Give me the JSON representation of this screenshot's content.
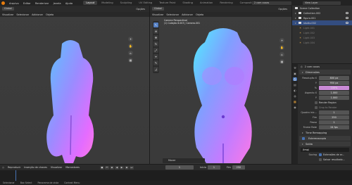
{
  "topbar": {
    "menus": [
      "Arquivo",
      "Editar",
      "Renderizar",
      "Janela",
      "Ajuda"
    ],
    "workspaces": [
      "Layout",
      "Modeling",
      "Sculpting",
      "UV Editing",
      "Texture Paint",
      "Shading",
      "Animation",
      "Rendering",
      "Compositing",
      "Scrip"
    ],
    "active_workspace": "Layout",
    "scene_name": "2 com coxas",
    "view_layer": "View Layer"
  },
  "viewport_left": {
    "header_tools": [
      "Global",
      "Opções"
    ],
    "menu": [
      "Visualizar",
      "Selecionar",
      "Adicionar",
      "Objeto"
    ]
  },
  "viewport_right": {
    "header_tools": [
      "Global",
      "Opções"
    ],
    "menu": [
      "Visualizar",
      "Selecionar",
      "Adicionar",
      "Objeto"
    ],
    "info_line1": "Camera Perspectival",
    "info_line2": "(1) Coleção 8.003 | Camera.001",
    "last_op": "Mover"
  },
  "outliner": {
    "title": "Scene Collection",
    "items": [
      {
        "label": "Collection.002",
        "selected": false,
        "dim": false
      },
      {
        "label": "figura.001",
        "selected": false,
        "dim": false
      },
      {
        "label": "studio.002",
        "selected": true,
        "dim": false
      },
      {
        "label": "Light.001",
        "selected": false,
        "dim": true
      },
      {
        "label": "Light.002",
        "selected": false,
        "dim": true
      },
      {
        "label": "Light.003",
        "selected": false,
        "dim": true
      },
      {
        "label": "Light.004",
        "selected": false,
        "dim": true
      }
    ]
  },
  "properties": {
    "scene_label": "2 com coxas",
    "dimensions_title": "Dimensões",
    "res_x_label": "Resolução X",
    "res_x": "800 px",
    "res_y_label": "Y",
    "res_y": "950 px",
    "pct_label": "%",
    "pct": "100%",
    "aspect_x_label": "Aspecto X",
    "aspect_x": "1.000",
    "aspect_y_label": "Y",
    "aspect_y": "1.000",
    "render_region": "Render Region",
    "crop": "Crop to Render",
    "frame_start_label": "Quadro inic...",
    "frame_start": "1",
    "frame_end_label": "Fim",
    "frame_end": "250",
    "step_label": "Passo",
    "step": "1",
    "fps_label": "Frame Rate",
    "fps": "24 fps",
    "sections": [
      "Time Remapping",
      "Estereoscopia",
      "Saída"
    ],
    "output_path": "/tmp\\",
    "saving_label": "Saving",
    "file_ext": "Extensões de ar...",
    "cache": "Salvar resultado..."
  },
  "timeline": {
    "menu": [
      "Reproduzir",
      "Inserção de chaves",
      "Visualizar",
      "Marcadores"
    ],
    "current_frame": "1",
    "start_label": "Início",
    "start": "1",
    "end_label": "Fim",
    "end": "250"
  },
  "status": {
    "items": [
      "Selecionar",
      "Box Select",
      "Panorama da vista",
      "Context Menu"
    ]
  },
  "colors": {
    "accent": "#4772b3",
    "orange": "#e87d0d",
    "viewport_bg": "#3d3d3d"
  }
}
